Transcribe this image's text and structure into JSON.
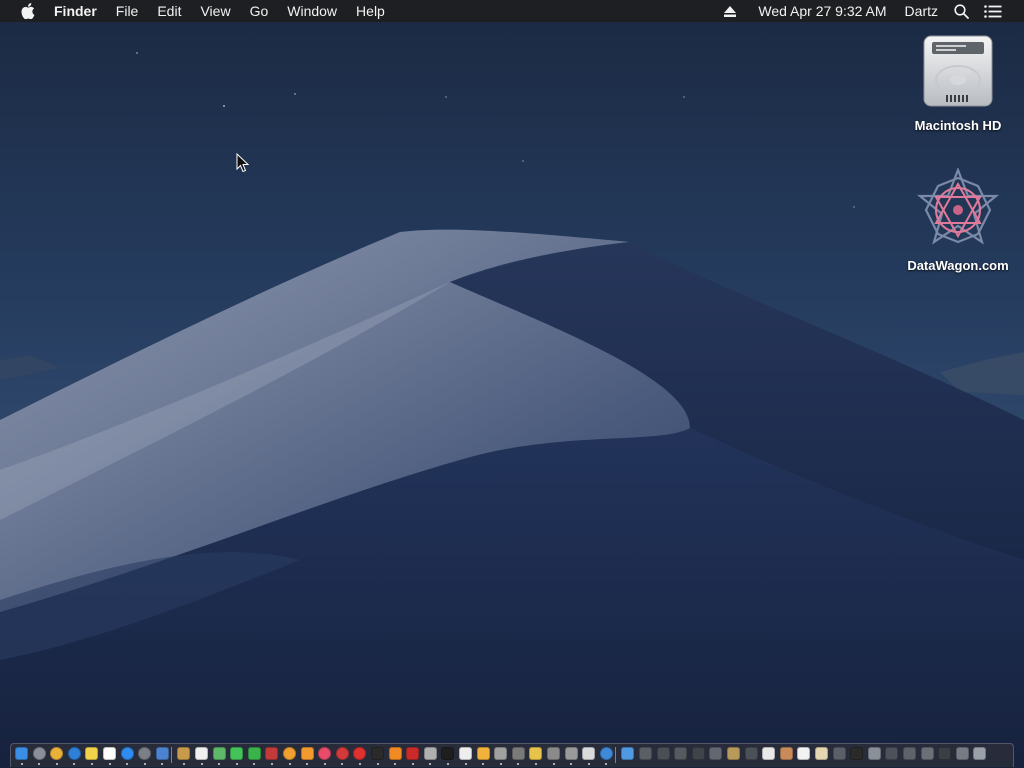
{
  "menubar": {
    "apple_icon": "apple-logo-icon",
    "app_name": "Finder",
    "menus": [
      "File",
      "Edit",
      "View",
      "Go",
      "Window",
      "Help"
    ],
    "clock": "Wed Apr 27  9:32 AM",
    "user": "Dartz",
    "status_icons": [
      "eject-icon",
      "spotlight-search-icon",
      "notification-center-icon"
    ]
  },
  "desktop": {
    "icons": [
      {
        "label": "Macintosh HD",
        "icon": "hard-drive-icon"
      },
      {
        "label": "DataWagon.com",
        "icon": "datawagon-star-icon"
      }
    ],
    "cursor_icon": "arrow-cursor-icon"
  },
  "dock": {
    "apps": [
      {
        "icon": "finder-icon",
        "color": "#3a8ee6"
      },
      {
        "icon": "launchpad-icon",
        "color": "#8a8f99"
      },
      {
        "icon": "chrome-icon",
        "color": "#e8b23a"
      },
      {
        "icon": "safari-icon",
        "color": "#2e7fd6"
      },
      {
        "icon": "notes-icon",
        "color": "#f2d24a"
      },
      {
        "icon": "calendar-icon",
        "color": "#ffffff"
      },
      {
        "icon": "app-store-icon",
        "color": "#2f8cf0"
      },
      {
        "icon": "system-preferences-icon",
        "color": "#7c7f86"
      },
      {
        "icon": "preview-icon",
        "color": "#4c83d0"
      },
      {
        "icon": "notefile-icon",
        "color": "#c99a4a"
      },
      {
        "icon": "textedit-icon",
        "color": "#f0f0f0"
      },
      {
        "icon": "maps-icon",
        "color": "#5fb86a"
      },
      {
        "icon": "messages-icon",
        "color": "#43c35a"
      },
      {
        "icon": "facetime-icon",
        "color": "#39b34a"
      },
      {
        "icon": "photo-booth-icon",
        "color": "#c23a3a"
      },
      {
        "icon": "photos-icon",
        "color": "#f0a030"
      },
      {
        "icon": "home-icon",
        "color": "#f29a2e"
      },
      {
        "icon": "music-icon",
        "color": "#e94c6a"
      },
      {
        "icon": "podcasts-icon",
        "color": "#d23a3a"
      },
      {
        "icon": "no-entry-icon",
        "color": "#e03030"
      },
      {
        "icon": "stocks-icon",
        "color": "#2a2a2a"
      },
      {
        "icon": "books-icon",
        "color": "#f08a24"
      },
      {
        "icon": "acrobat-icon",
        "color": "#c92b2b"
      },
      {
        "icon": "scripts-icon",
        "color": "#b0b0b0"
      },
      {
        "icon": "terminal-icon",
        "color": "#1e1e1e"
      },
      {
        "icon": "document-icon",
        "color": "#eeeeee"
      },
      {
        "icon": "sketch-icon",
        "color": "#f0b23a"
      },
      {
        "icon": "archive-icon",
        "color": "#a0a0a0"
      },
      {
        "icon": "utility-icon",
        "color": "#7a7a7a"
      },
      {
        "icon": "folder-icon",
        "color": "#e8c34a"
      },
      {
        "icon": "telescope-icon",
        "color": "#8a8a8a"
      },
      {
        "icon": "printer-icon",
        "color": "#9a9a9a"
      },
      {
        "icon": "report-icon",
        "color": "#dadada"
      },
      {
        "icon": "app-store-folder-icon",
        "color": "#3f8ad8"
      },
      {
        "icon": "downloads-folder-icon",
        "color": "#4f9ae0"
      },
      {
        "icon": "window-icon",
        "color": "#5a5f66"
      },
      {
        "icon": "window-icon",
        "color": "#4a4f56"
      },
      {
        "icon": "window-icon",
        "color": "#555a61"
      },
      {
        "icon": "window-icon",
        "color": "#3f444b"
      },
      {
        "icon": "window-icon",
        "color": "#626770"
      },
      {
        "icon": "window-icon",
        "color": "#b89a5a"
      },
      {
        "icon": "window-icon",
        "color": "#4c5158"
      },
      {
        "icon": "window-icon",
        "color": "#e8e8e8"
      },
      {
        "icon": "window-icon",
        "color": "#c98b5a"
      },
      {
        "icon": "window-icon",
        "color": "#f2f2f2"
      },
      {
        "icon": "window-icon",
        "color": "#e4d6b0"
      },
      {
        "icon": "window-icon",
        "color": "#5b6068"
      },
      {
        "icon": "window-icon",
        "color": "#2a2a2a"
      },
      {
        "icon": "window-icon",
        "color": "#8a9099"
      },
      {
        "icon": "window-icon",
        "color": "#4d525a"
      },
      {
        "icon": "window-icon",
        "color": "#5e636b"
      },
      {
        "icon": "window-icon",
        "color": "#6b7078"
      },
      {
        "icon": "window-icon",
        "color": "#3a3f46"
      },
      {
        "icon": "window-icon",
        "color": "#777c84"
      },
      {
        "icon": "trash-icon",
        "color": "#9aa0a8"
      }
    ]
  }
}
